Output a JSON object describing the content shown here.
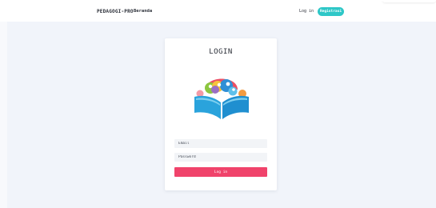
{
  "navbar": {
    "brand": "PEDAGOGI-PRO",
    "links": [
      {
        "label": "Beranda"
      }
    ],
    "login_label": "Log in",
    "register_label": "Registrasi"
  },
  "login_card": {
    "title": "LOGIN",
    "logo_icon": "open-book-with-people-logo",
    "email_placeholder": "Email",
    "password_placeholder": "Password",
    "submit_label": "Log in"
  },
  "colors": {
    "accent_teal": "#2ec7c7",
    "accent_pink": "#f0436b",
    "background": "#f1f4fa"
  }
}
